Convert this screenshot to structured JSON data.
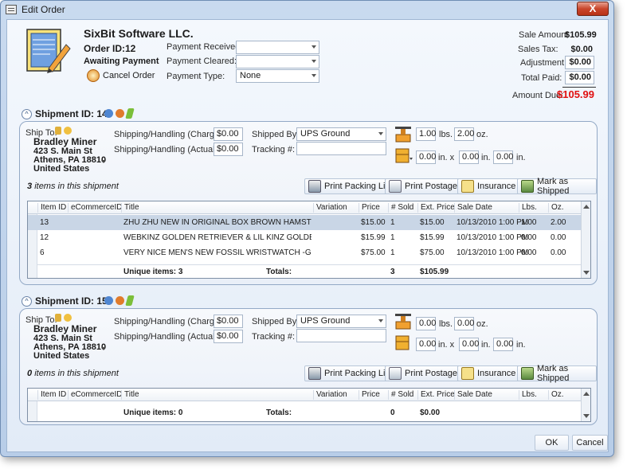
{
  "window": {
    "title": "Edit Order",
    "close_label": "X"
  },
  "header": {
    "company": "SixBit Software LLC.",
    "order_id": "Order ID:12",
    "status": "Awaiting Payment",
    "cancel_order": "Cancel Order",
    "payment_received_label": "Payment Received:",
    "payment_cleared_label": "Payment Cleared:",
    "payment_type_label": "Payment Type:",
    "payment_received_value": "",
    "payment_cleared_value": "",
    "payment_type_value": "None"
  },
  "summary": {
    "sale_amount_label": "Sale Amount",
    "sale_amount": "$105.99",
    "sales_tax_label": "Sales Tax:",
    "sales_tax": "$0.00",
    "adjustment_label": "Adjustment:",
    "adjustment": "$0.00",
    "total_paid_label": "Total Paid:",
    "total_paid": "$0.00",
    "amount_due_label": "Amount Due:",
    "amount_due": "$105.99",
    "amount_due_color": "#e01010"
  },
  "shipments": [
    {
      "title": "Shipment ID: 14",
      "ship_to_label": "Ship To:",
      "name": "Bradley Miner",
      "addr1": "423 S. Main St",
      "addr2": "Athens, PA 18810",
      "country": "United States",
      "sh_charged_label": "Shipping/Handling (Charged):",
      "sh_charged": "$0.00",
      "sh_actual_label": "Shipping/Handling (Actual):",
      "sh_actual": "$0.00",
      "shipped_by_label": "Shipped By:",
      "shipped_by": "UPS Ground",
      "tracking_label": "Tracking #:",
      "tracking": "",
      "weight_lbs": "1.00",
      "lbs_label": "lbs.",
      "weight_oz": "2.00",
      "oz_label": "oz.",
      "dim_l": "0.00",
      "dim_w": "0.00",
      "dim_h": "0.00",
      "in_x": "in. x",
      "in": "in.",
      "item_count": "3",
      "items_text": "items in this shipment",
      "buttons": {
        "packing": "Print Packing List",
        "postage": "Print Postage",
        "insurance": "Insurance",
        "shipped": "Mark as Shipped"
      },
      "columns": [
        "Item ID",
        "eCommerceID",
        "Title",
        "Variation",
        "Price",
        "# Sold",
        "Ext. Price",
        "Sale Date",
        "Lbs.",
        "Oz."
      ],
      "rows": [
        {
          "id": "13",
          "ecom": "",
          "title": "ZHU ZHU NEW IN ORIGINAL BOX BROWN HAMSTER MR.SQUIG...",
          "variation": "",
          "price": "$15.00",
          "sold": "1",
          "ext": "$15.00",
          "date": "10/13/2010 1:00 PM",
          "lbs": "1.00",
          "oz": "2.00"
        },
        {
          "id": "12",
          "ecom": "",
          "title": "WEBKINZ GOLDEN RETRIEVER & LIL KINZ GOLDEN RETRIEVER",
          "variation": "",
          "price": "$15.99",
          "sold": "1",
          "ext": "$15.99",
          "date": "10/13/2010 1:00 PM",
          "lbs": "0.00",
          "oz": "0.00"
        },
        {
          "id": "6",
          "ecom": "",
          "title": "VERY NICE MEN'S NEW FOSSIL WRISTWATCH -GREAT XMAS GIFT",
          "variation": "",
          "price": "$75.00",
          "sold": "1",
          "ext": "$75.00",
          "date": "10/13/2010 1:00 PM",
          "lbs": "0.00",
          "oz": "0.00"
        }
      ],
      "unique_items": "Unique items: 3",
      "totals_label": "Totals:",
      "total_sold": "3",
      "total_ext": "$105.99"
    },
    {
      "title": "Shipment ID: 15",
      "ship_to_label": "Ship To:",
      "name": "Bradley Miner",
      "addr1": "423 S. Main St",
      "addr2": "Athens, PA 18810",
      "country": "United States",
      "sh_charged_label": "Shipping/Handling (Charged):",
      "sh_charged": "$0.00",
      "sh_actual_label": "Shipping/Handling (Actual):",
      "sh_actual": "$0.00",
      "shipped_by_label": "Shipped By:",
      "shipped_by": "UPS Ground",
      "tracking_label": "Tracking #:",
      "tracking": "",
      "weight_lbs": "0.00",
      "lbs_label": "lbs.",
      "weight_oz": "0.00",
      "oz_label": "oz.",
      "dim_l": "0.00",
      "dim_w": "0.00",
      "dim_h": "0.00",
      "in_x": "in. x",
      "in": "in.",
      "item_count": "0",
      "items_text": "items in this shipment",
      "buttons": {
        "packing": "Print Packing List",
        "postage": "Print Postage",
        "insurance": "Insurance",
        "shipped": "Mark as Shipped"
      },
      "columns": [
        "Item ID",
        "eCommerceID",
        "Title",
        "Variation",
        "Price",
        "# Sold",
        "Ext. Price",
        "Sale Date",
        "Lbs.",
        "Oz."
      ],
      "rows": [],
      "unique_items": "Unique items: 0",
      "totals_label": "Totals:",
      "total_sold": "0",
      "total_ext": "$0.00"
    }
  ],
  "footer": {
    "ok": "OK",
    "cancel": "Cancel"
  },
  "icons": [
    "document-pencil-icon",
    "cancel-order-icon",
    "edit-icon",
    "info-icon",
    "refresh-icon",
    "scale-icon",
    "box-icon",
    "printer-icon",
    "postage-icon",
    "insurance-icon",
    "shipped-icon"
  ]
}
